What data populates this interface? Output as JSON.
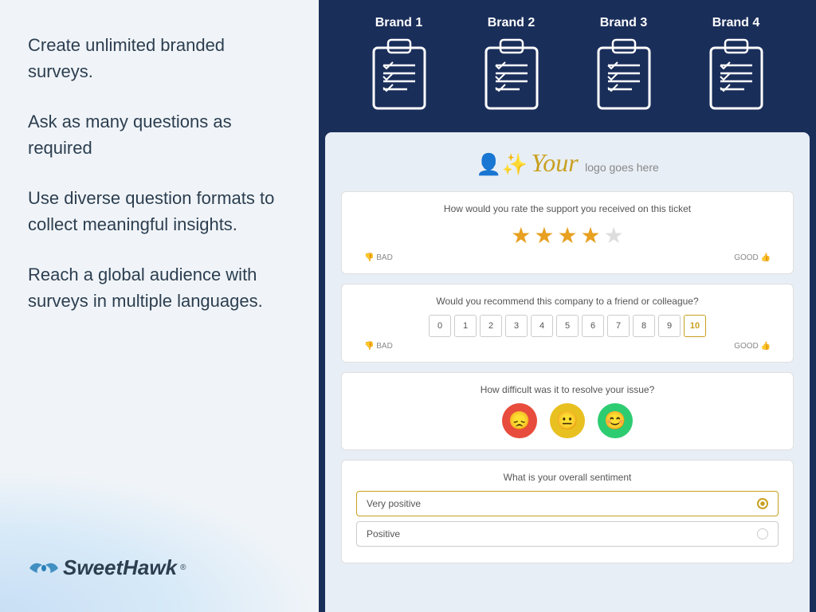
{
  "left": {
    "features": [
      "Create unlimited branded surveys.",
      "Ask as many questions as required",
      "Use diverse question formats to collect meaningful insights.",
      "Reach a global audience with surveys in multiple languages."
    ],
    "logo": {
      "name": "SweetHawk",
      "registered": "®"
    }
  },
  "right": {
    "brands": [
      {
        "label": "Brand 1"
      },
      {
        "label": "Brand 2"
      },
      {
        "label": "Brand 3"
      },
      {
        "label": "Brand 4"
      }
    ],
    "survey": {
      "logo_text": "Your",
      "logo_caption": "logo goes here",
      "questions": [
        {
          "text": "How would you rate the support you received on this ticket",
          "type": "stars",
          "stars": 4,
          "bad_label": "BAD",
          "good_label": "GOOD"
        },
        {
          "text": "Would you recommend this company to a friend or colleague?",
          "type": "nps",
          "options": [
            "0",
            "1",
            "2",
            "3",
            "4",
            "5",
            "6",
            "7",
            "8",
            "9",
            "10"
          ],
          "selected": "10",
          "bad_label": "BAD",
          "good_label": "GOOD"
        },
        {
          "text": "How difficult was it to resolve your issue?",
          "type": "emoji"
        },
        {
          "text": "What is your overall sentiment",
          "type": "sentiment",
          "options": [
            "Very positive",
            "Positive"
          ],
          "selected": "Very positive"
        }
      ]
    }
  }
}
